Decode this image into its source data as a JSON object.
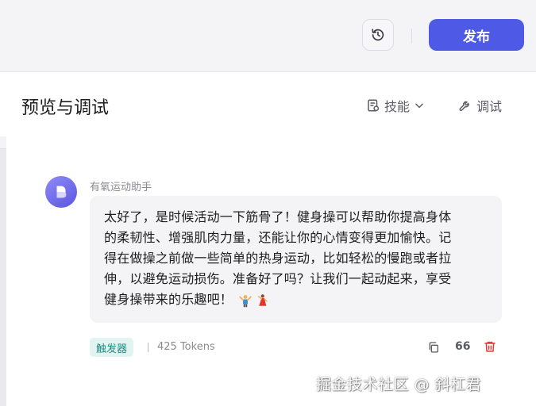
{
  "toolbar": {
    "history_icon": "history-icon",
    "publish_label": "发布",
    "accent_color": "#4e5ae6"
  },
  "panel": {
    "title": "预览与调试",
    "skills_label": "技能",
    "debug_label": "调试"
  },
  "message": {
    "sender": "有氧运动助手",
    "lines": [
      "太好了，是时候活动一下筋骨了！健身操可以帮助你提高身体",
      "的柔韧性、增强肌肉力量，还能让你的心情变得更加愉快。记",
      "得在做操之前做一些简单的热身运动，比如轻松的慢跑或者拉",
      "伸，以避免运动损伤。准备好了吗？让我们一起动起来，享受",
      "健身操带来的乐趣吧！"
    ],
    "emojis": [
      "flexing-person-emoji",
      "dancing-woman-emoji"
    ]
  },
  "footer": {
    "trigger_label": "触发器",
    "tokens": "425 Tokens",
    "quote_label": "66"
  },
  "watermark": "掘金技术社区 @ 斜杠君"
}
